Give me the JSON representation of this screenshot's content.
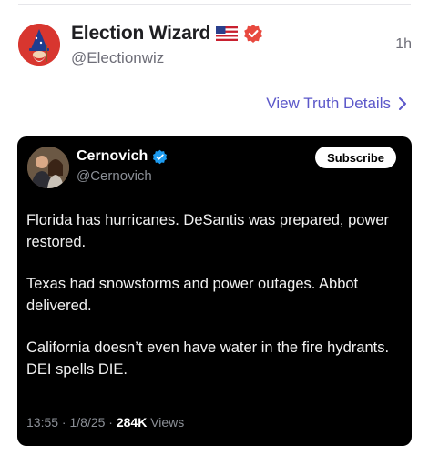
{
  "post": {
    "author_name": "Election Wizard",
    "author_handle": "@Electionwiz",
    "time": "1h",
    "view_details_label": "View Truth Details"
  },
  "embed": {
    "author_name": "Cernovich",
    "author_handle": "@Cernovich",
    "subscribe_label": "Subscribe",
    "paragraphs": [
      "Florida has hurricanes. DeSantis was prepared, power restored.",
      "Texas had snowstorms and power outages. Abbot delivered.",
      "California doesn’t even have water in the fire hydrants. DEI spells DIE."
    ],
    "timestamp": "13:55 · 1/8/25 · ",
    "views_count": "284K",
    "views_label": " Views"
  },
  "colors": {
    "accent_link": "#5b57c9",
    "verified_badge": "#e8493f",
    "x_verified": "#1d9bf0",
    "embed_bg": "#000000"
  },
  "icons": {
    "flag": "us-flag-icon",
    "verified": "verified-badge-icon",
    "chevron": "chevron-right-icon",
    "x_verified": "x-verified-check-icon"
  }
}
